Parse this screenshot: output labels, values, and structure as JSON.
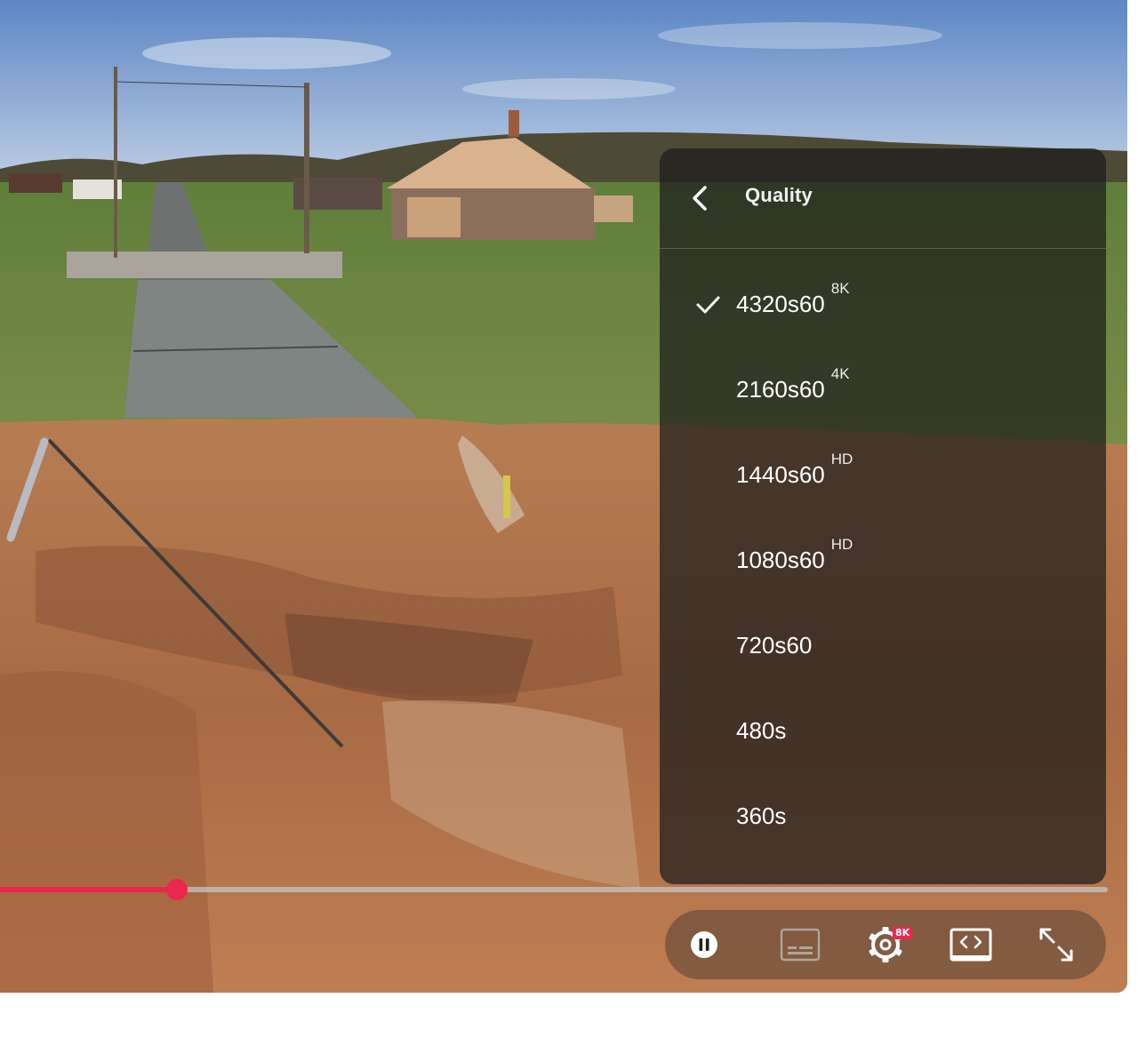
{
  "quality_menu": {
    "title": "Quality",
    "options": [
      {
        "label": "4320s60",
        "badge": "8K",
        "selected": true
      },
      {
        "label": "2160s60",
        "badge": "4K",
        "selected": false
      },
      {
        "label": "1440s60",
        "badge": "HD",
        "selected": false
      },
      {
        "label": "1080s60",
        "badge": "HD",
        "selected": false
      },
      {
        "label": "720s60",
        "badge": "",
        "selected": false
      },
      {
        "label": "480s",
        "badge": "",
        "selected": false
      },
      {
        "label": "360s",
        "badge": "",
        "selected": false
      }
    ]
  },
  "progress": {
    "played_fraction": 0.16
  },
  "controls": {
    "settings_badge": "8K",
    "icons": [
      "pause-icon",
      "captions-icon",
      "settings-icon",
      "embed-icon",
      "fullscreen-icon"
    ]
  },
  "colors": {
    "accent": "#e8284e",
    "menu_bg": "#1c1c1c"
  }
}
